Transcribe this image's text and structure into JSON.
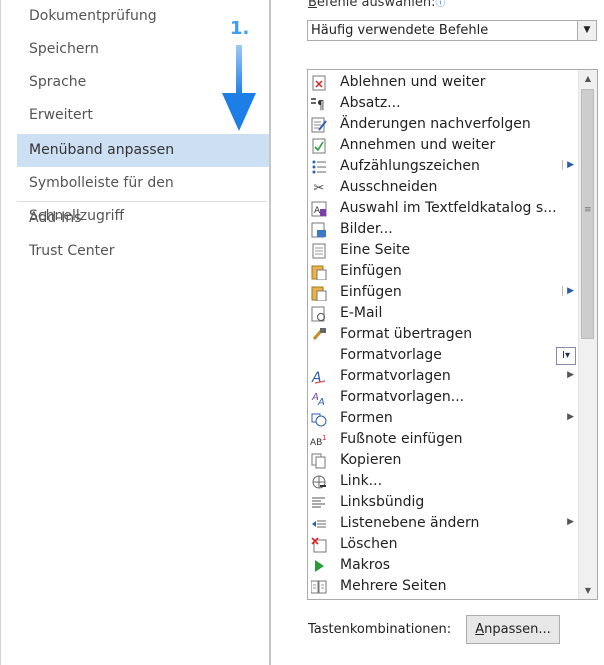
{
  "nav": {
    "items": [
      {
        "label": "Dokumentprüfung"
      },
      {
        "label": "Speichern"
      },
      {
        "label": "Sprache"
      },
      {
        "label": "Erweitert"
      },
      {
        "label": "Menüband anpassen"
      },
      {
        "label": "Symbolleiste für den Schnellzugriff"
      },
      {
        "label": "Add-Ins"
      },
      {
        "label": "Trust Center"
      }
    ]
  },
  "annotation": {
    "step": "1."
  },
  "commands": {
    "label_prefix": "B",
    "label_rest": "efehle auswählen:",
    "info_icon": "ⓘ",
    "combo_value": "Häufig verwendete Befehle",
    "list": [
      {
        "label": "Ablehnen und weiter",
        "icon": "reject-change-icon"
      },
      {
        "label": "Absatz...",
        "icon": "paragraph-icon"
      },
      {
        "label": "Änderungen nachverfolgen",
        "icon": "track-changes-icon"
      },
      {
        "label": "Annehmen und weiter",
        "icon": "accept-change-icon"
      },
      {
        "label": "Aufzählungszeichen",
        "icon": "bullets-icon"
      },
      {
        "label": "Ausschneiden",
        "icon": "scissors-icon"
      },
      {
        "label": "Auswahl im Textfeldkatalog s...",
        "icon": "textbox-gallery-icon"
      },
      {
        "label": "Bilder...",
        "icon": "picture-icon"
      },
      {
        "label": "Eine Seite",
        "icon": "one-page-icon"
      },
      {
        "label": "Einfügen",
        "icon": "paste-icon"
      },
      {
        "label": "Einfügen",
        "icon": "paste-icon"
      },
      {
        "label": "E-Mail",
        "icon": "email-icon"
      },
      {
        "label": "Format übertragen",
        "icon": "format-painter-icon"
      },
      {
        "label": "Formatvorlage",
        "icon": ""
      },
      {
        "label": "Formatvorlagen",
        "icon": "styles-icon"
      },
      {
        "label": "Formatvorlagen...",
        "icon": "styles-dialog-icon"
      },
      {
        "label": "Formen",
        "icon": "shapes-icon"
      },
      {
        "label": "Fußnote einfügen",
        "icon": "footnote-icon"
      },
      {
        "label": "Kopieren",
        "icon": "copy-icon"
      },
      {
        "label": "Link...",
        "icon": "link-icon"
      },
      {
        "label": "Linksbündig",
        "icon": "align-left-icon"
      },
      {
        "label": "Listenebene ändern",
        "icon": "list-level-icon"
      },
      {
        "label": "Löschen",
        "icon": "delete-icon"
      },
      {
        "label": "Makros",
        "icon": "macros-icon"
      },
      {
        "label": "Mehrere Seiten",
        "icon": "multiple-pages-icon"
      }
    ]
  },
  "keyboard": {
    "label": "Tastenkombinationen:",
    "button_u": "A",
    "button_rest": "npassen...",
    "button_pre": ""
  }
}
